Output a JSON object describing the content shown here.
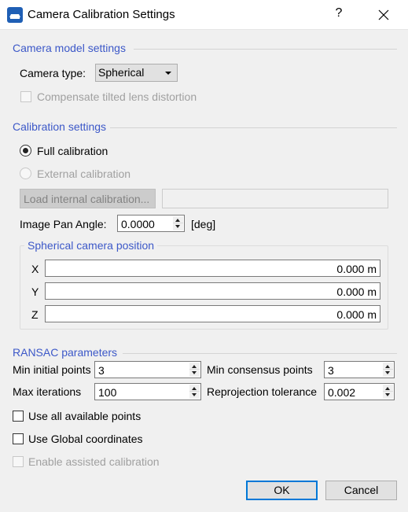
{
  "window": {
    "title": "Camera Calibration Settings",
    "help": "?"
  },
  "camera_model": {
    "section_title": "Camera model settings",
    "camera_type_label": "Camera type:",
    "camera_type_value": "Spherical",
    "compensate_label": "Compensate tilted lens distortion"
  },
  "calibration": {
    "section_title": "Calibration settings",
    "full_label": "Full calibration",
    "external_label": "External calibration",
    "load_button": "Load internal calibration...",
    "pan_label": "Image Pan Angle:",
    "pan_value": "0.0000",
    "pan_unit": "[deg]",
    "position_title": "Spherical camera position",
    "x_label": "X",
    "x_value": "0.000 m",
    "y_label": "Y",
    "y_value": "0.000 m",
    "z_label": "Z",
    "z_value": "0.000 m"
  },
  "ransac": {
    "section_title": "RANSAC parameters",
    "min_initial_label": "Min initial points",
    "min_initial_value": "3",
    "min_consensus_label": "Min consensus points",
    "min_consensus_value": "3",
    "max_iter_label": "Max iterations",
    "max_iter_value": "100",
    "reproj_label": "Reprojection tolerance",
    "reproj_value": "0.002"
  },
  "options": {
    "use_all_label": "Use all available points",
    "use_global_label": "Use Global coordinates",
    "assisted_label": "Enable assisted calibration"
  },
  "buttons": {
    "ok": "OK",
    "cancel": "Cancel"
  },
  "colors": {
    "section_title": "#3c58c8",
    "default_button_border": "#0078d7"
  },
  "icons": {
    "app": "camera-app-icon",
    "close": "close-icon",
    "spin": "spin-arrows-icon"
  }
}
